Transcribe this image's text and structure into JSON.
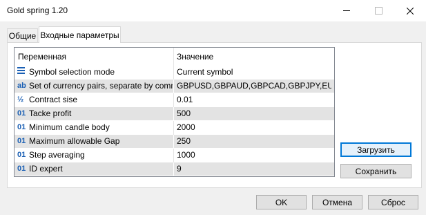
{
  "window": {
    "title": "Gold spring 1.20"
  },
  "tabs": [
    {
      "label": "Общие"
    },
    {
      "label": "Входные параметры"
    }
  ],
  "table": {
    "headers": {
      "variable": "Переменная",
      "value": "Значение"
    },
    "rows": [
      {
        "icon": "enum-list-icon",
        "name": "Symbol selection mode",
        "value": "Current symbol"
      },
      {
        "icon": "string-ab-icon",
        "name": "Set of currency pairs, separate by comma",
        "value": "GBPUSD,GBPAUD,GBPCAD,GBPJPY,EURUSD..."
      },
      {
        "icon": "fraction-half-icon",
        "name": "Contract sise",
        "value": "0.01"
      },
      {
        "icon": "integer-01-icon",
        "name": "Tacke profit",
        "value": "500"
      },
      {
        "icon": "integer-01-icon",
        "name": "Minimum candle body",
        "value": "2000"
      },
      {
        "icon": "integer-01-icon",
        "name": "Maximum allowable Gap",
        "value": "250"
      },
      {
        "icon": "integer-01-icon",
        "name": "Step averaging",
        "value": "1000"
      },
      {
        "icon": "integer-01-icon",
        "name": "ID expert",
        "value": "9"
      }
    ]
  },
  "side_buttons": {
    "load": "Загрузить",
    "save": "Сохранить"
  },
  "footer_buttons": {
    "ok": "OK",
    "cancel": "Отмена",
    "reset": "Сброс"
  },
  "icon_glyphs": {
    "ab": "ab",
    "half": "½",
    "int": "01"
  },
  "colors": {
    "accent": "#0078d7",
    "icon_blue": "#1a5fb4",
    "icon_orange": "#c28a00",
    "row_alt": "#e3e3e3"
  }
}
